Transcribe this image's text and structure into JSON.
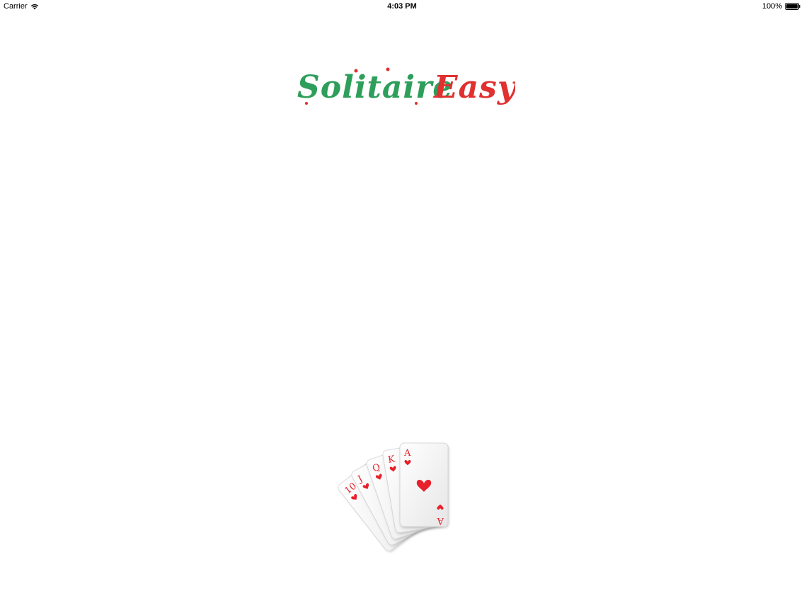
{
  "status_bar": {
    "carrier": "Carrier",
    "time": "4:03 PM",
    "battery_percent": "100%",
    "battery_level": 1.0
  },
  "title": {
    "word1": "Solitaire",
    "word2": "Easy",
    "color_word1": "#2e9e5b",
    "color_word2": "#e0302f"
  },
  "cards": {
    "ranks": [
      "10",
      "J",
      "Q",
      "K",
      "A"
    ],
    "suit_icon": "heart-icon",
    "suit_color": "#e8202a"
  }
}
